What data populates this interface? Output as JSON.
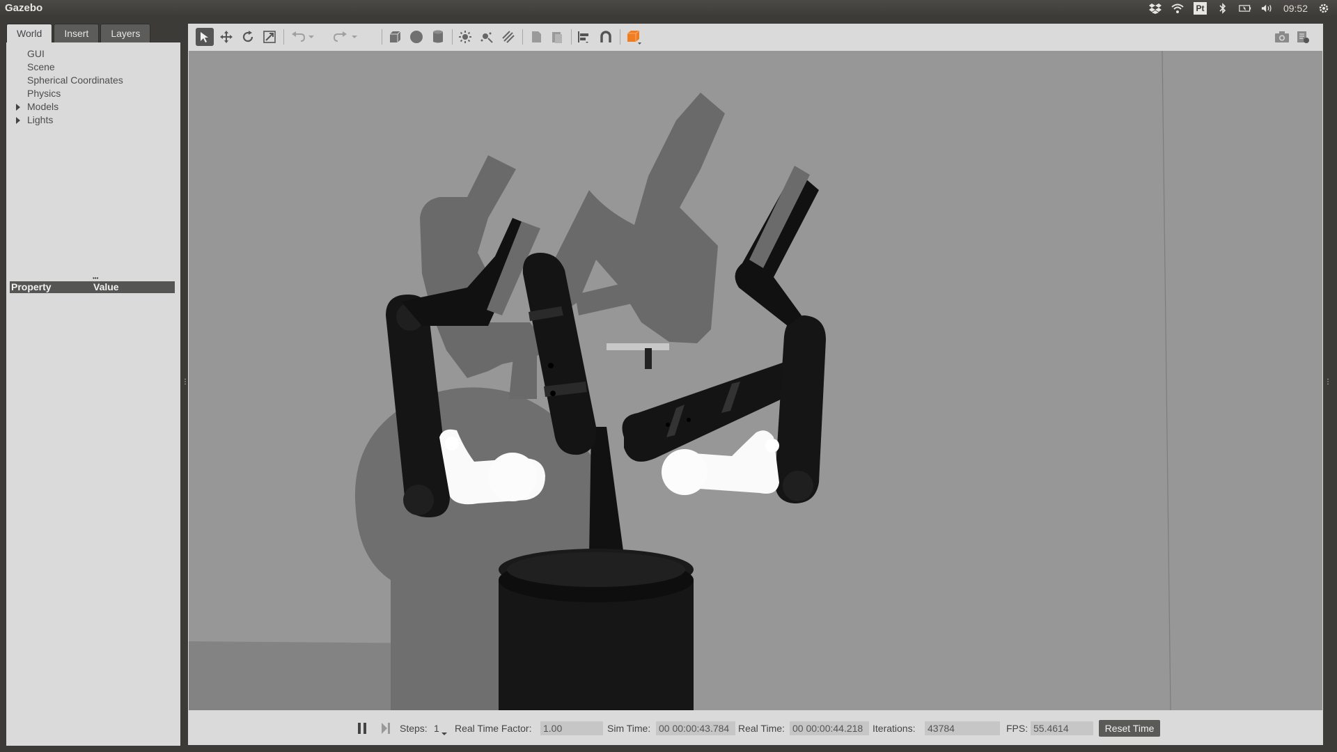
{
  "app": {
    "title": "Gazebo",
    "clock": "09:52"
  },
  "tray_icons": [
    "dropbox-icon",
    "wifi-icon",
    "pycharm-icon",
    "bluetooth-icon",
    "battery-icon",
    "volume-icon",
    "settings-gear-icon"
  ],
  "tray_pt_label": "Pt",
  "left_panel": {
    "tabs": [
      {
        "label": "World",
        "active": true
      },
      {
        "label": "Insert",
        "active": false
      },
      {
        "label": "Layers",
        "active": false
      }
    ],
    "tree": [
      {
        "label": "GUI",
        "expandable": false
      },
      {
        "label": "Scene",
        "expandable": false
      },
      {
        "label": "Spherical Coordinates",
        "expandable": false
      },
      {
        "label": "Physics",
        "expandable": false
      },
      {
        "label": "Models",
        "expandable": true
      },
      {
        "label": "Lights",
        "expandable": true
      }
    ],
    "property_header": {
      "property": "Property",
      "value": "Value"
    }
  },
  "toolbar": {
    "tools": [
      "select-mode-icon",
      "translate-mode-icon",
      "rotate-mode-icon",
      "scale-mode-icon",
      "undo-icon",
      "undo-history-icon",
      "redo-icon",
      "redo-history-icon",
      "box-shape-icon",
      "sphere-shape-icon",
      "cylinder-shape-icon",
      "point-light-icon",
      "spot-light-icon",
      "directional-light-icon",
      "copy-icon",
      "paste-icon",
      "align-icon",
      "snap-icon",
      "view-angle-icon",
      "screenshot-icon",
      "log-icon"
    ]
  },
  "bottom_bar": {
    "steps_label": "Steps:",
    "steps_value": "1",
    "real_time_factor_label": "Real Time Factor:",
    "real_time_factor_value": "1.00",
    "sim_time_label": "Sim Time:",
    "sim_time_value": "00 00:00:43.784",
    "real_time_label": "Real Time:",
    "real_time_value": "00 00:00:44.218",
    "iterations_label": "Iterations:",
    "iterations_value": "43784",
    "fps_label": "FPS:",
    "fps_value": "55.4614",
    "reset_time_label": "Reset Time"
  },
  "colors": {
    "viewport_bg": "#979797",
    "panel_bg": "#dadada",
    "window_bg": "#3c3b37",
    "orange_accent": "#f07d21"
  }
}
